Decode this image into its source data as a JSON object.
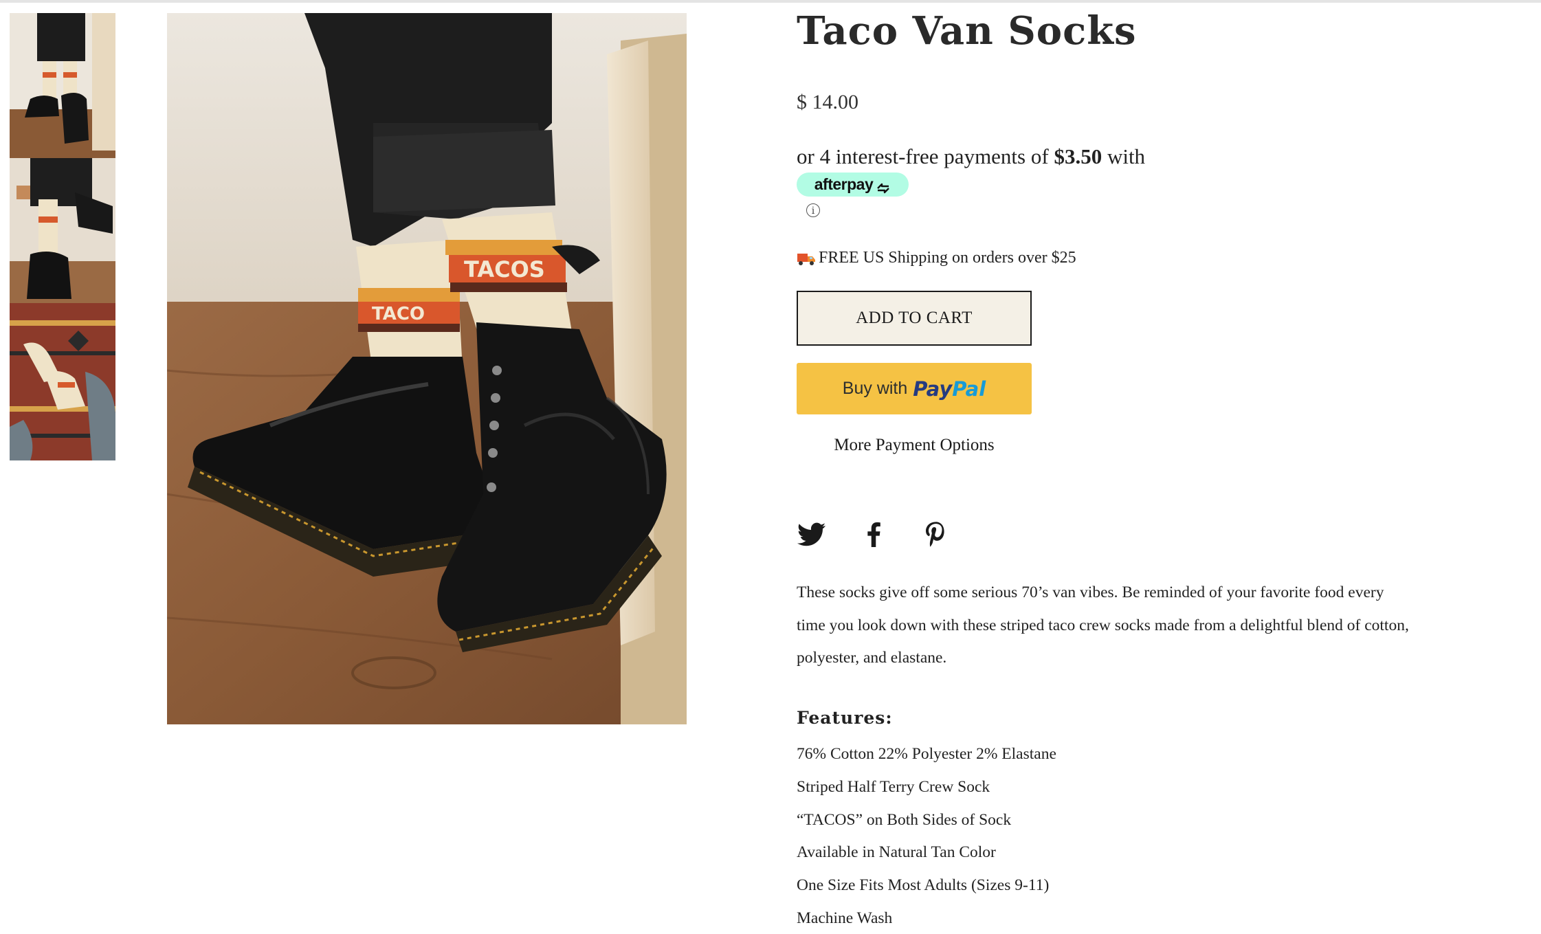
{
  "product": {
    "title": "Taco Van Socks",
    "price": "$ 14.00"
  },
  "afterpay": {
    "text_before": "or 4 interest-free payments of ",
    "amount": "$3.50",
    "text_after": " with",
    "badge_label": "afterpay",
    "info_glyph": "ⓘ"
  },
  "shipping": {
    "icon": "truck-icon",
    "text": "FREE US Shipping on orders over $25"
  },
  "buttons": {
    "add_to_cart": "ADD TO CART",
    "paypal_prefix": "Buy with",
    "paypal_pay": "Pay",
    "paypal_pal": "Pal",
    "more_payment": "More Payment Options"
  },
  "social": [
    {
      "name": "twitter-icon"
    },
    {
      "name": "facebook-icon"
    },
    {
      "name": "pinterest-icon"
    }
  ],
  "description": "These socks give off some serious 70’s van vibes. Be reminded of your favorite food every time you look down with these striped taco crew socks made from a delightful blend of cotton, polyester, and elastane.",
  "features": {
    "heading": "Features:",
    "items": [
      "76% Cotton 22% Polyester 2% Elastane",
      "Striped Half Terry Crew Sock",
      "“TACOS” on Both Sides of Sock",
      "Available in Natural Tan Color",
      "One Size Fits Most Adults (Sizes 9-11)",
      "Machine Wash"
    ]
  },
  "colors": {
    "afterpay_mint": "#b2fce4",
    "paypal_yellow": "#f5c244",
    "cart_bg": "#f4f0e6",
    "paypal_navy": "#253b80",
    "paypal_blue": "#179bd7"
  }
}
